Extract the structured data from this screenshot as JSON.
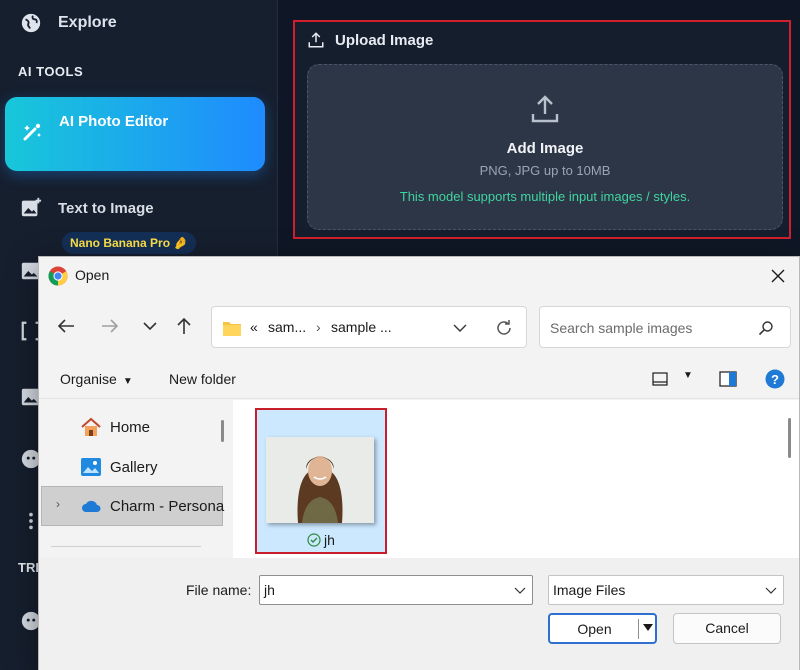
{
  "sidebar": {
    "explore_label": "Explore",
    "section_ai_tools": "AI TOOLS",
    "active_item": {
      "title": "AI Photo Editor",
      "badge": "Nano Banana Pro 🤌"
    },
    "text_to_image_label": "Text to Image",
    "section_trending_partial": "TRE"
  },
  "upload": {
    "title": "Upload Image",
    "add_label": "Add Image",
    "formats": "PNG, JPG up to 10MB",
    "note": "This model supports multiple input images / styles."
  },
  "dialog": {
    "title": "Open",
    "address": {
      "overflow": "«",
      "segment1": "sam...",
      "segment2": "sample ..."
    },
    "search_placeholder": "Search sample images",
    "toolbar": {
      "organise": "Organise",
      "new_folder": "New folder"
    },
    "nav_pane": [
      "Home",
      "Gallery",
      "Charm - Persona"
    ],
    "file": {
      "name": "jh"
    },
    "file_name_label": "File name:",
    "file_name_value": "jh",
    "file_type": "Image Files",
    "open_label": "Open",
    "cancel_label": "Cancel"
  },
  "colors": {
    "accent_gradient_start": "#18c7d9",
    "accent_gradient_end": "#1f8bff",
    "highlight_red": "#d0202f",
    "note_green": "#3fd5a0",
    "selection_blue": "#cce8ff"
  }
}
